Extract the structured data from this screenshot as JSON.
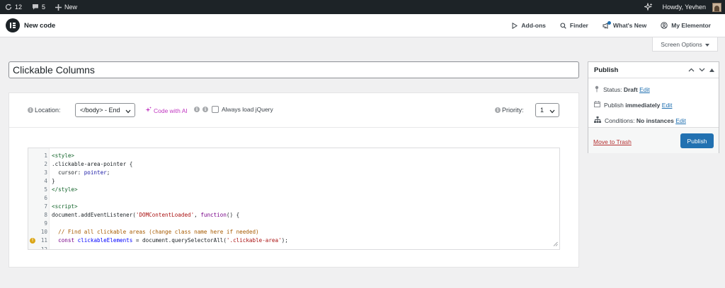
{
  "admin_bar": {
    "updates_count": "12",
    "comments_count": "5",
    "new_label": "New",
    "greeting": "Howdy, Yevhen"
  },
  "header": {
    "page_title": "New code",
    "nav": [
      "Add-ons",
      "Finder",
      "What's New",
      "My Elementor"
    ]
  },
  "screen_options": {
    "label": "Screen Options"
  },
  "title_field": {
    "value": "Clickable Columns"
  },
  "options_bar": {
    "location_label": "Location:",
    "location_value": "</body> - End",
    "ai_label": "Code with AI",
    "jquery_label": "Always load jQuery",
    "jquery_checked": false,
    "priority_label": "Priority:",
    "priority_value": "1"
  },
  "code_editor": {
    "warning_line": 11,
    "lines": [
      "<style>",
      ".clickable-area-pointer {",
      "  cursor: pointer;",
      "}",
      "</style>",
      "",
      "<script>",
      "document.addEventListener('DOMContentLoaded', function() {",
      "",
      "  // Find all clickable areas (change class name here if needed)",
      "  const clickableElements = document.querySelectorAll('.clickable-area');",
      ""
    ]
  },
  "publish_box": {
    "title": "Publish",
    "status_label": "Status:",
    "status_value": "Draft",
    "status_edit": "Edit",
    "publish_label": "Publish",
    "publish_value": "immediately",
    "publish_edit": "Edit",
    "conditions_label": "Conditions:",
    "conditions_value": "No instances",
    "conditions_edit": "Edit",
    "trash_label": "Move to Trash",
    "publish_button": "Publish"
  },
  "colors": {
    "admin_bar_bg": "#1d2327",
    "primary_button": "#2271b1",
    "ai_accent": "#c036c0",
    "trash_red": "#b32d2e"
  }
}
